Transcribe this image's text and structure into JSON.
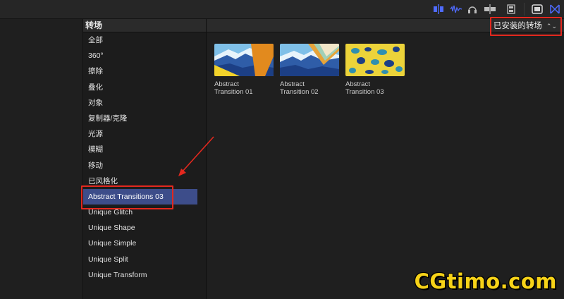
{
  "toolbar": {
    "icons": [
      "audio-align-icon",
      "waveform-icon",
      "headphones-icon",
      "clip-skimming-icon",
      "filmstrip-icon",
      "inspector-icon",
      "transitions-icon"
    ]
  },
  "sidebar": {
    "title": "转场",
    "items": [
      {
        "label": "全部"
      },
      {
        "label": "360°"
      },
      {
        "label": "擦除"
      },
      {
        "label": "叠化"
      },
      {
        "label": "对象"
      },
      {
        "label": "复制器/克隆"
      },
      {
        "label": "光源"
      },
      {
        "label": "模糊"
      },
      {
        "label": "移动"
      },
      {
        "label": "已风格化"
      },
      {
        "label": "Abstract Transitions 03",
        "selected": true
      },
      {
        "label": "Unique Glitch"
      },
      {
        "label": "Unique Shape"
      },
      {
        "label": "Unique Simple"
      },
      {
        "label": "Unique Split"
      },
      {
        "label": "Unique Transform"
      }
    ]
  },
  "browser": {
    "filter_label": "已安装的转场",
    "items": [
      {
        "label_line1": "Abstract",
        "label_line2": "Transition 01"
      },
      {
        "label_line1": "Abstract",
        "label_line2": "Transition 02"
      },
      {
        "label_line1": "Abstract",
        "label_line2": "Transition 03"
      }
    ]
  },
  "colors": {
    "accent_selected": "#3d4d8a",
    "annotation_red": "#e3281e",
    "toolbar_blue": "#4f6bff",
    "watermark": "#f7d318"
  },
  "watermark": "CGtimo.com"
}
